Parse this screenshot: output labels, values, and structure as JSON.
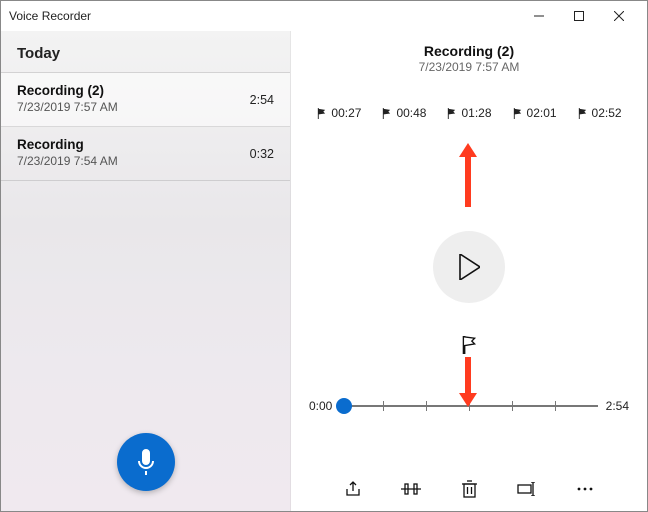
{
  "window": {
    "title": "Voice Recorder",
    "min": "—",
    "max": "☐",
    "close": "✕"
  },
  "sidebar": {
    "heading": "Today",
    "items": [
      {
        "title": "Recording (2)",
        "date": "7/23/2019 7:57 AM",
        "duration": "2:54"
      },
      {
        "title": "Recording",
        "date": "7/23/2019 7:54 AM",
        "duration": "0:32"
      }
    ]
  },
  "current": {
    "title": "Recording (2)",
    "date": "7/23/2019 7:57 AM"
  },
  "markers": [
    "00:27",
    "00:48",
    "01:28",
    "02:01",
    "02:52"
  ],
  "timeline": {
    "start": "0:00",
    "end": "2:54"
  },
  "colors": {
    "accent": "#0a6cce",
    "annotation": "#ff3b1f"
  }
}
